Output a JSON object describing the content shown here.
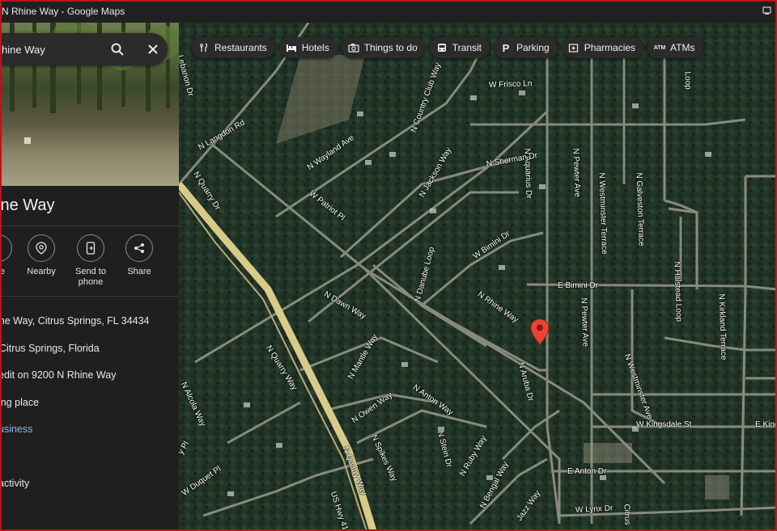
{
  "window": {
    "title": "N Rhine Way - Google Maps"
  },
  "search": {
    "value": "hine Way"
  },
  "place": {
    "title": "ine Way"
  },
  "actions": [
    {
      "label": "e"
    },
    {
      "label": "Nearby"
    },
    {
      "label": "Send to phone"
    },
    {
      "label": "Share"
    }
  ],
  "details": [
    {
      "text": "ine Way, Citrus Springs, FL 34434"
    },
    {
      "text": "Citrus Springs, Florida"
    },
    {
      "text": "edit on 9200 N Rhine Way"
    },
    {
      "text": "ing place"
    },
    {
      "text": "usiness"
    },
    {
      "text": "activity"
    }
  ],
  "chips": [
    {
      "label": "Restaurants",
      "icon": "fork-knife-icon"
    },
    {
      "label": "Hotels",
      "icon": "bed-icon"
    },
    {
      "label": "Things to do",
      "icon": "camera-icon"
    },
    {
      "label": "Transit",
      "icon": "bus-icon"
    },
    {
      "label": "Parking",
      "icon": "parking-icon"
    },
    {
      "label": "Pharmacies",
      "icon": "pharmacy-icon"
    },
    {
      "label": "ATMs",
      "icon": "atm-icon"
    }
  ],
  "roads": [
    "Lebanon Dr",
    "N Langdon Rd",
    "N Quarry Dr",
    "N Wayland Ave",
    "W Patriot Pl",
    "N Country Club Way",
    "N Jackson Way",
    "W Frisco Ln",
    "N Aquarius Dr",
    "N Sherman Dr",
    "N Pewter Ave",
    "N Westminster Terrace",
    "N Galveston Terrace",
    "N Halstead Loop",
    "N Kirkland Terrace",
    "W Bimini Dr",
    "E Bimini Dr",
    "N Danube Loop",
    "N Rhine Way",
    "N Aruba Dr",
    "N Dawn Way",
    "N Quarry Way",
    "N Mantle Way",
    "N Alcola Way",
    "N Owen Way",
    "N Anton Way",
    "N Spikes Way",
    "N Stein Dr",
    "N Ruby Way",
    "N Bengal Way",
    "W Duquet Pl",
    "N Quarry Way",
    "US Hwy 41",
    "E Anton Dr",
    "W Lynx Dr",
    "Citrus",
    "W Kingsdale St",
    "E King",
    "N Westminster Ave",
    "N Pewter Ave",
    "Jazz Way",
    "Loop",
    "y Pl"
  ],
  "accent": {
    "pin": "#ea4335",
    "link": "#8ab4f8",
    "frame": "#c0121a"
  }
}
